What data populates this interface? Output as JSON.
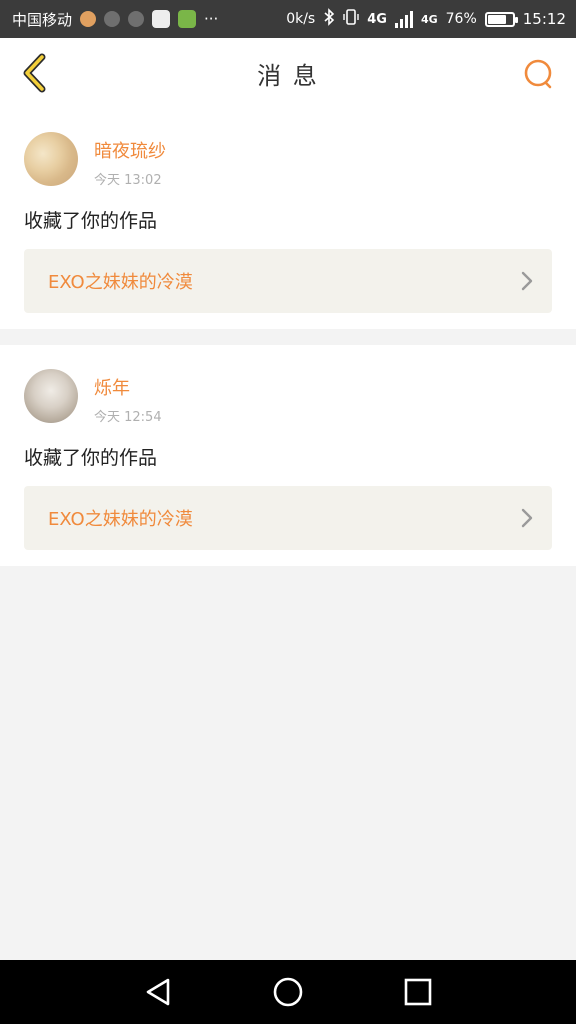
{
  "status_bar": {
    "carrier": "中国移动",
    "more": "···",
    "speed": "0k/s",
    "network": "4G",
    "network2": "4G",
    "battery_text": "76%",
    "battery_level": 0.76,
    "time": "15:12"
  },
  "header": {
    "title": "消 息",
    "back_icon": "chevron-left-icon",
    "search_icon": "search-icon"
  },
  "messages": [
    {
      "username": "暗夜琉纱",
      "time": "今天 13:02",
      "action": "收藏了你的作品",
      "work_title": "EXO之妹妹的冷漠"
    },
    {
      "username": "烁年",
      "time": "今天 12:54",
      "action": "收藏了你的作品",
      "work_title": "EXO之妹妹的冷漠"
    }
  ],
  "colors": {
    "accent": "#f08a3c",
    "status_bar": "#3b3b3b",
    "background": "#f3f3f3",
    "link_bg": "#f3f2ec"
  },
  "nav": {
    "back_icon": "triangle-back-icon",
    "home_icon": "circle-home-icon",
    "recents_icon": "square-recents-icon"
  }
}
